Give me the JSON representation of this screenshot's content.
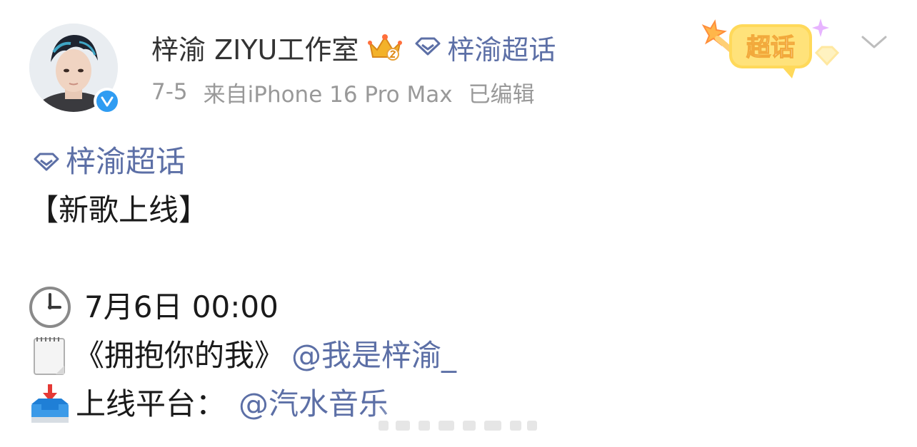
{
  "header": {
    "username": "梓渝 ZIYU工作室",
    "topic": "梓渝超话",
    "meta": {
      "date": "7-5",
      "source": "来自iPhone 16 Pro Max",
      "edited": "已编辑"
    },
    "sticker_text": "超话"
  },
  "post": {
    "topic": "梓渝超话",
    "title": "【新歌上线】",
    "time_line": "7月6日 00:00",
    "song_text": "《拥抱你的我》",
    "song_mention": "@我是梓渝_",
    "platform_text": "上线平台：",
    "platform_mention": "@汽水音乐"
  },
  "icons": {
    "verified": "verified-v-icon",
    "crown": "crown-badge-icon",
    "topic": "diamond-topic-icon",
    "clock": "clock-emoji",
    "notepad": "notepad-emoji",
    "inbox": "inbox-tray-emoji",
    "chevron": "chevron-down-icon"
  },
  "colors": {
    "link": "#5c6fa6",
    "meta": "#999999",
    "verified": "#2f9cf2",
    "sticker": "#ffd24d"
  }
}
